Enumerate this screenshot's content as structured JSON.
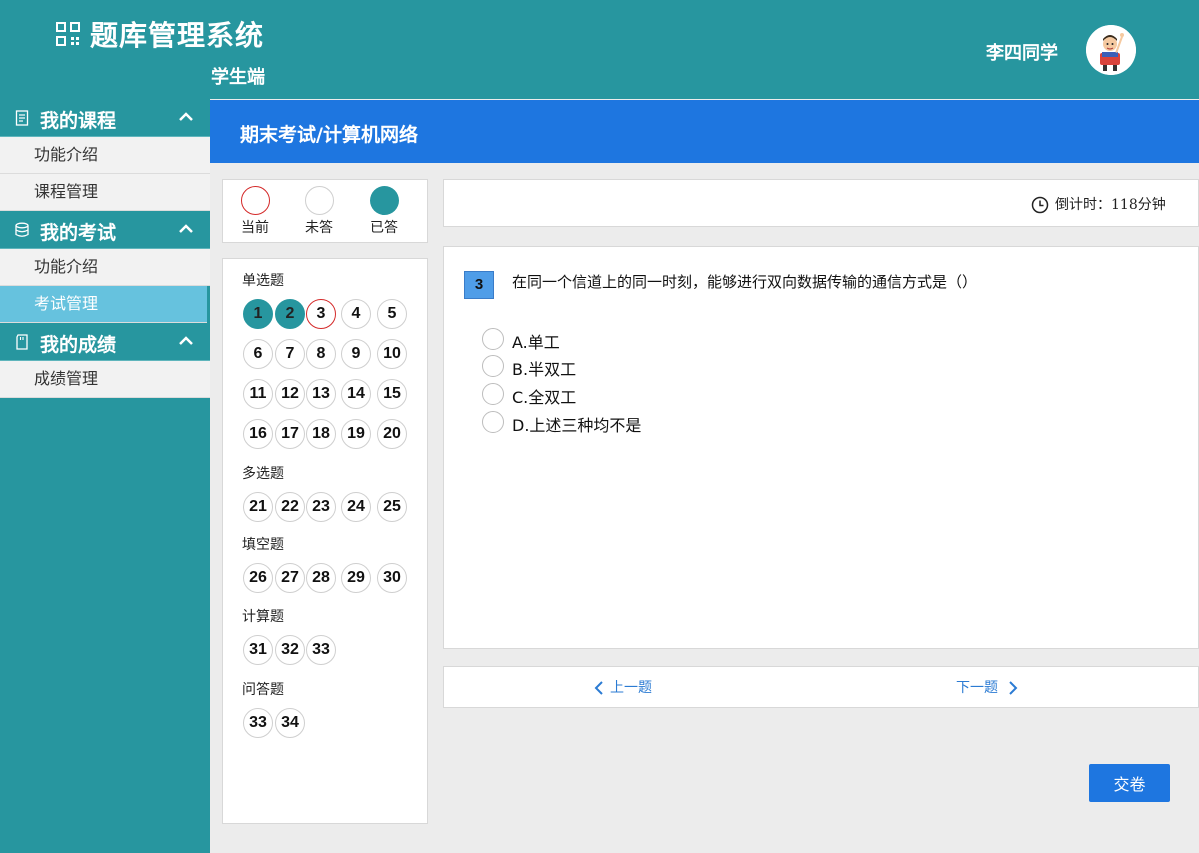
{
  "header": {
    "title": "题库管理系统",
    "subtitle": "学生端",
    "username": "李四同学"
  },
  "sidebar": {
    "groups": [
      {
        "label": "我的课程",
        "icon": "document-icon",
        "items": [
          {
            "label": "功能介绍"
          },
          {
            "label": "课程管理"
          }
        ]
      },
      {
        "label": "我的考试",
        "icon": "database-icon",
        "items": [
          {
            "label": "功能介绍"
          },
          {
            "label": "考试管理",
            "active": true
          }
        ]
      },
      {
        "label": "我的成绩",
        "icon": "sd-card-icon",
        "items": [
          {
            "label": "成绩管理"
          }
        ]
      }
    ]
  },
  "breadcrumb": "期末考试/计算机网络",
  "legend": {
    "current": "当前",
    "unanswered": "未答",
    "answered": "已答"
  },
  "navigator": {
    "sections": [
      {
        "label": "单选题",
        "numbers": [
          "1",
          "2",
          "3",
          "4",
          "5",
          "6",
          "7",
          "8",
          "9",
          "10",
          "11",
          "12",
          "13",
          "14",
          "15",
          "16",
          "17",
          "18",
          "19",
          "20"
        ]
      },
      {
        "label": "多选题",
        "numbers": [
          "21",
          "22",
          "23",
          "24",
          "25"
        ]
      },
      {
        "label": "填空题",
        "numbers": [
          "26",
          "27",
          "28",
          "29",
          "30"
        ]
      },
      {
        "label": "计算题",
        "numbers": [
          "31",
          "32",
          "33"
        ]
      },
      {
        "label": "问答题",
        "numbers": [
          "33",
          "34"
        ]
      }
    ],
    "answered": [
      "1",
      "2"
    ],
    "current": "3"
  },
  "timer": {
    "text": "倒计时：118分钟"
  },
  "question": {
    "number": "3",
    "text": "在同一个信道上的同一时刻，能够进行双向数据传输的通信方式是（）",
    "options": [
      "A.单工",
      "B.半双工",
      "C.全双工",
      "D.上述三种均不是"
    ]
  },
  "pager": {
    "prev": "上一题",
    "next": "下一题"
  },
  "submit_label": "交卷",
  "colors": {
    "header": "#27969f",
    "titlebar": "#1e76e0",
    "active_item": "#66c2de",
    "current_ring": "#d42a2a"
  }
}
